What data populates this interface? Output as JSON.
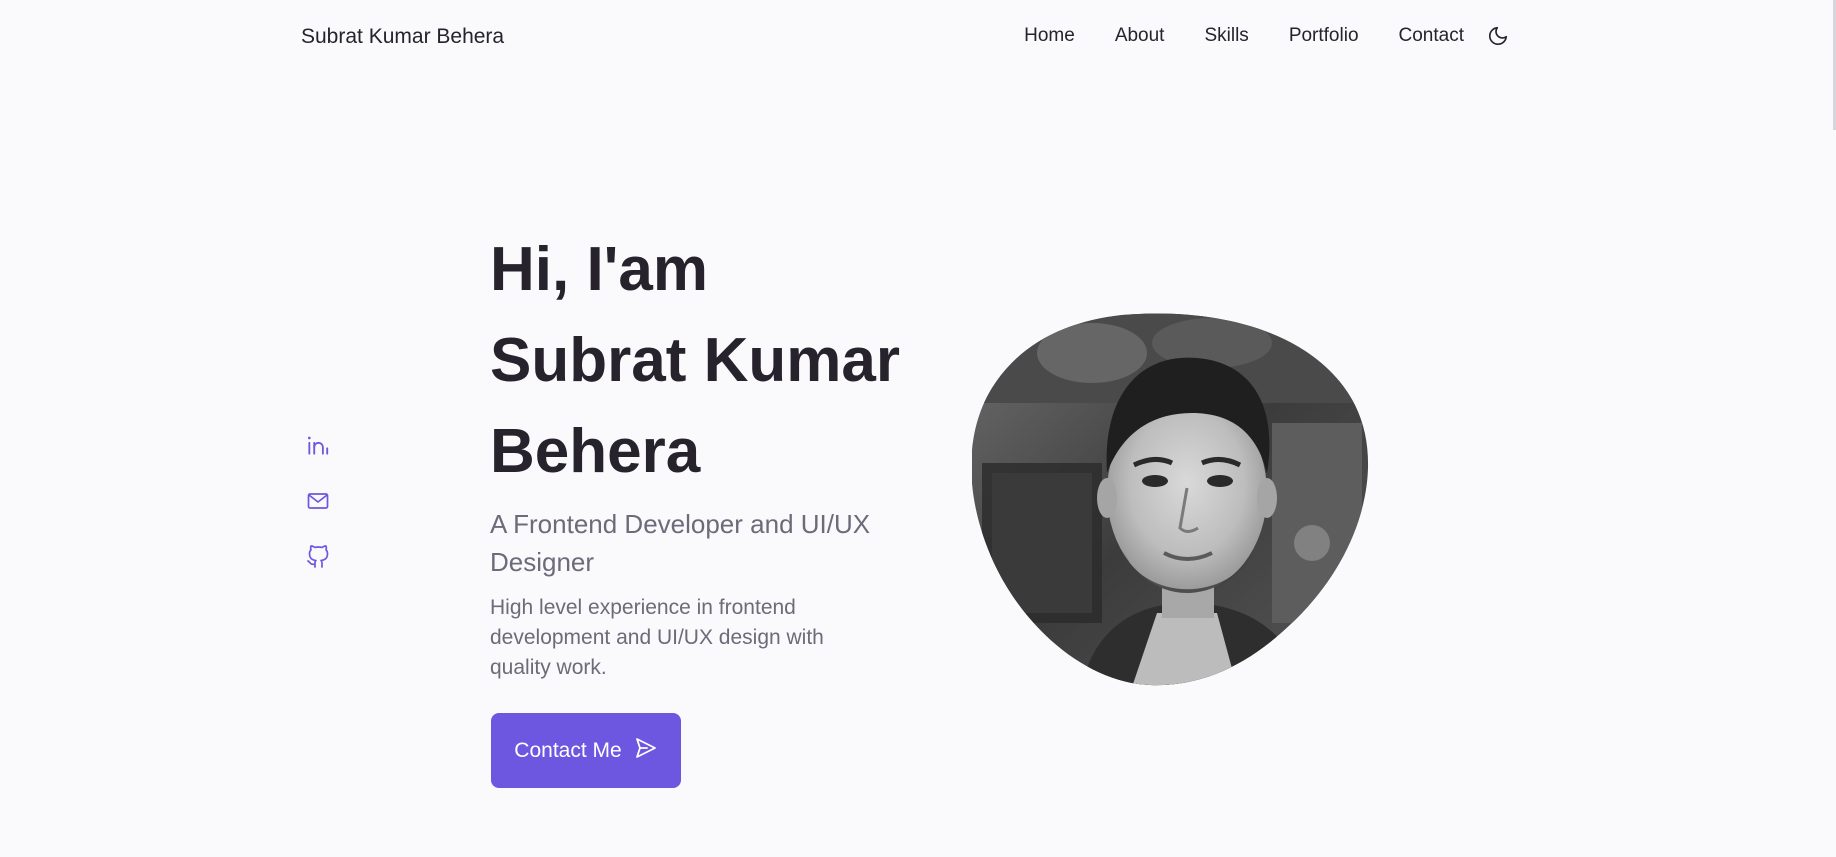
{
  "header": {
    "logo": "Subrat Kumar Behera",
    "nav": [
      {
        "label": "Home"
      },
      {
        "label": "About"
      },
      {
        "label": "Skills"
      },
      {
        "label": "Portfolio"
      },
      {
        "label": "Contact"
      }
    ],
    "theme_toggle_icon": "moon-icon"
  },
  "socials": [
    {
      "icon": "linkedin-icon"
    },
    {
      "icon": "mail-icon"
    },
    {
      "icon": "github-icon"
    }
  ],
  "hero": {
    "title_lines": [
      "Hi, I'am",
      "Subrat Kumar",
      "Behera"
    ],
    "subtitle": "A Frontend Developer and UI/UX Designer",
    "description": "High level experience in frontend development and UI/UX design with quality work.",
    "cta_label": "Contact Me",
    "cta_icon": "send-icon",
    "portrait_icon": "profile-photo"
  },
  "colors": {
    "accent": "#6d57e0",
    "text": "#26232d",
    "muted": "#6d6b79",
    "background": "#faf9fc"
  }
}
